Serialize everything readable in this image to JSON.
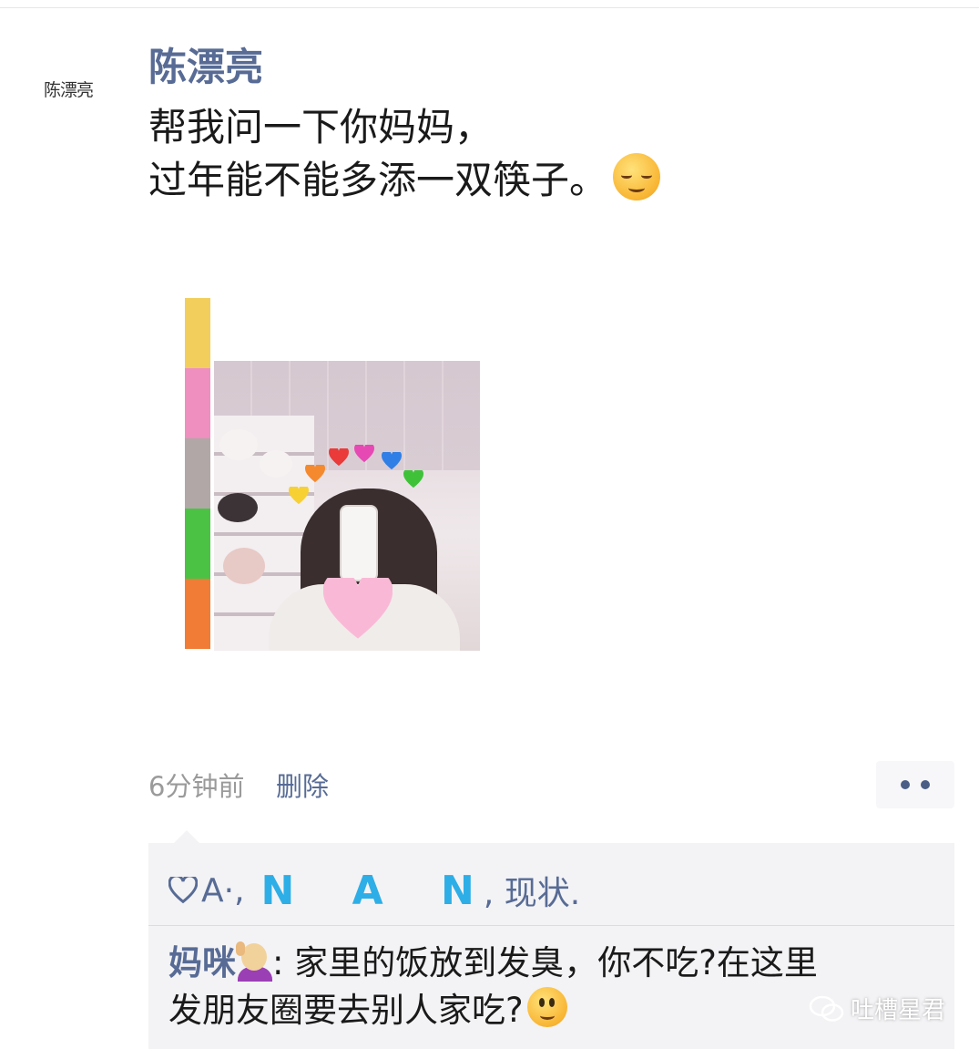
{
  "post": {
    "avatar_text": "陈漂亮",
    "nickname": "陈漂亮",
    "text_line1": "帮我问一下你妈妈，",
    "text_line2": "过年能不能多添一双筷子。",
    "text_emoji": "relieved-face-emoji",
    "color_bar": [
      "#f2cf5c",
      "#ef8fbf",
      "#b2a7a7",
      "#4cc245",
      "#f07c36"
    ],
    "time": "6分钟前",
    "delete_label": "删除"
  },
  "likes": {
    "prefix": "A·,",
    "nan": "N A N",
    "suffix": ", 现状."
  },
  "comment": {
    "author": "妈咪",
    "author_emoji": "person-raising-hand-emoji",
    "text_line1": ": 家里的饭放到发臭，你不吃?在这里",
    "text_line2": "发朋友圈要去别人家吃?",
    "text_emoji": "smiling-face-emoji"
  },
  "watermark": {
    "text": "吐槽星君"
  }
}
